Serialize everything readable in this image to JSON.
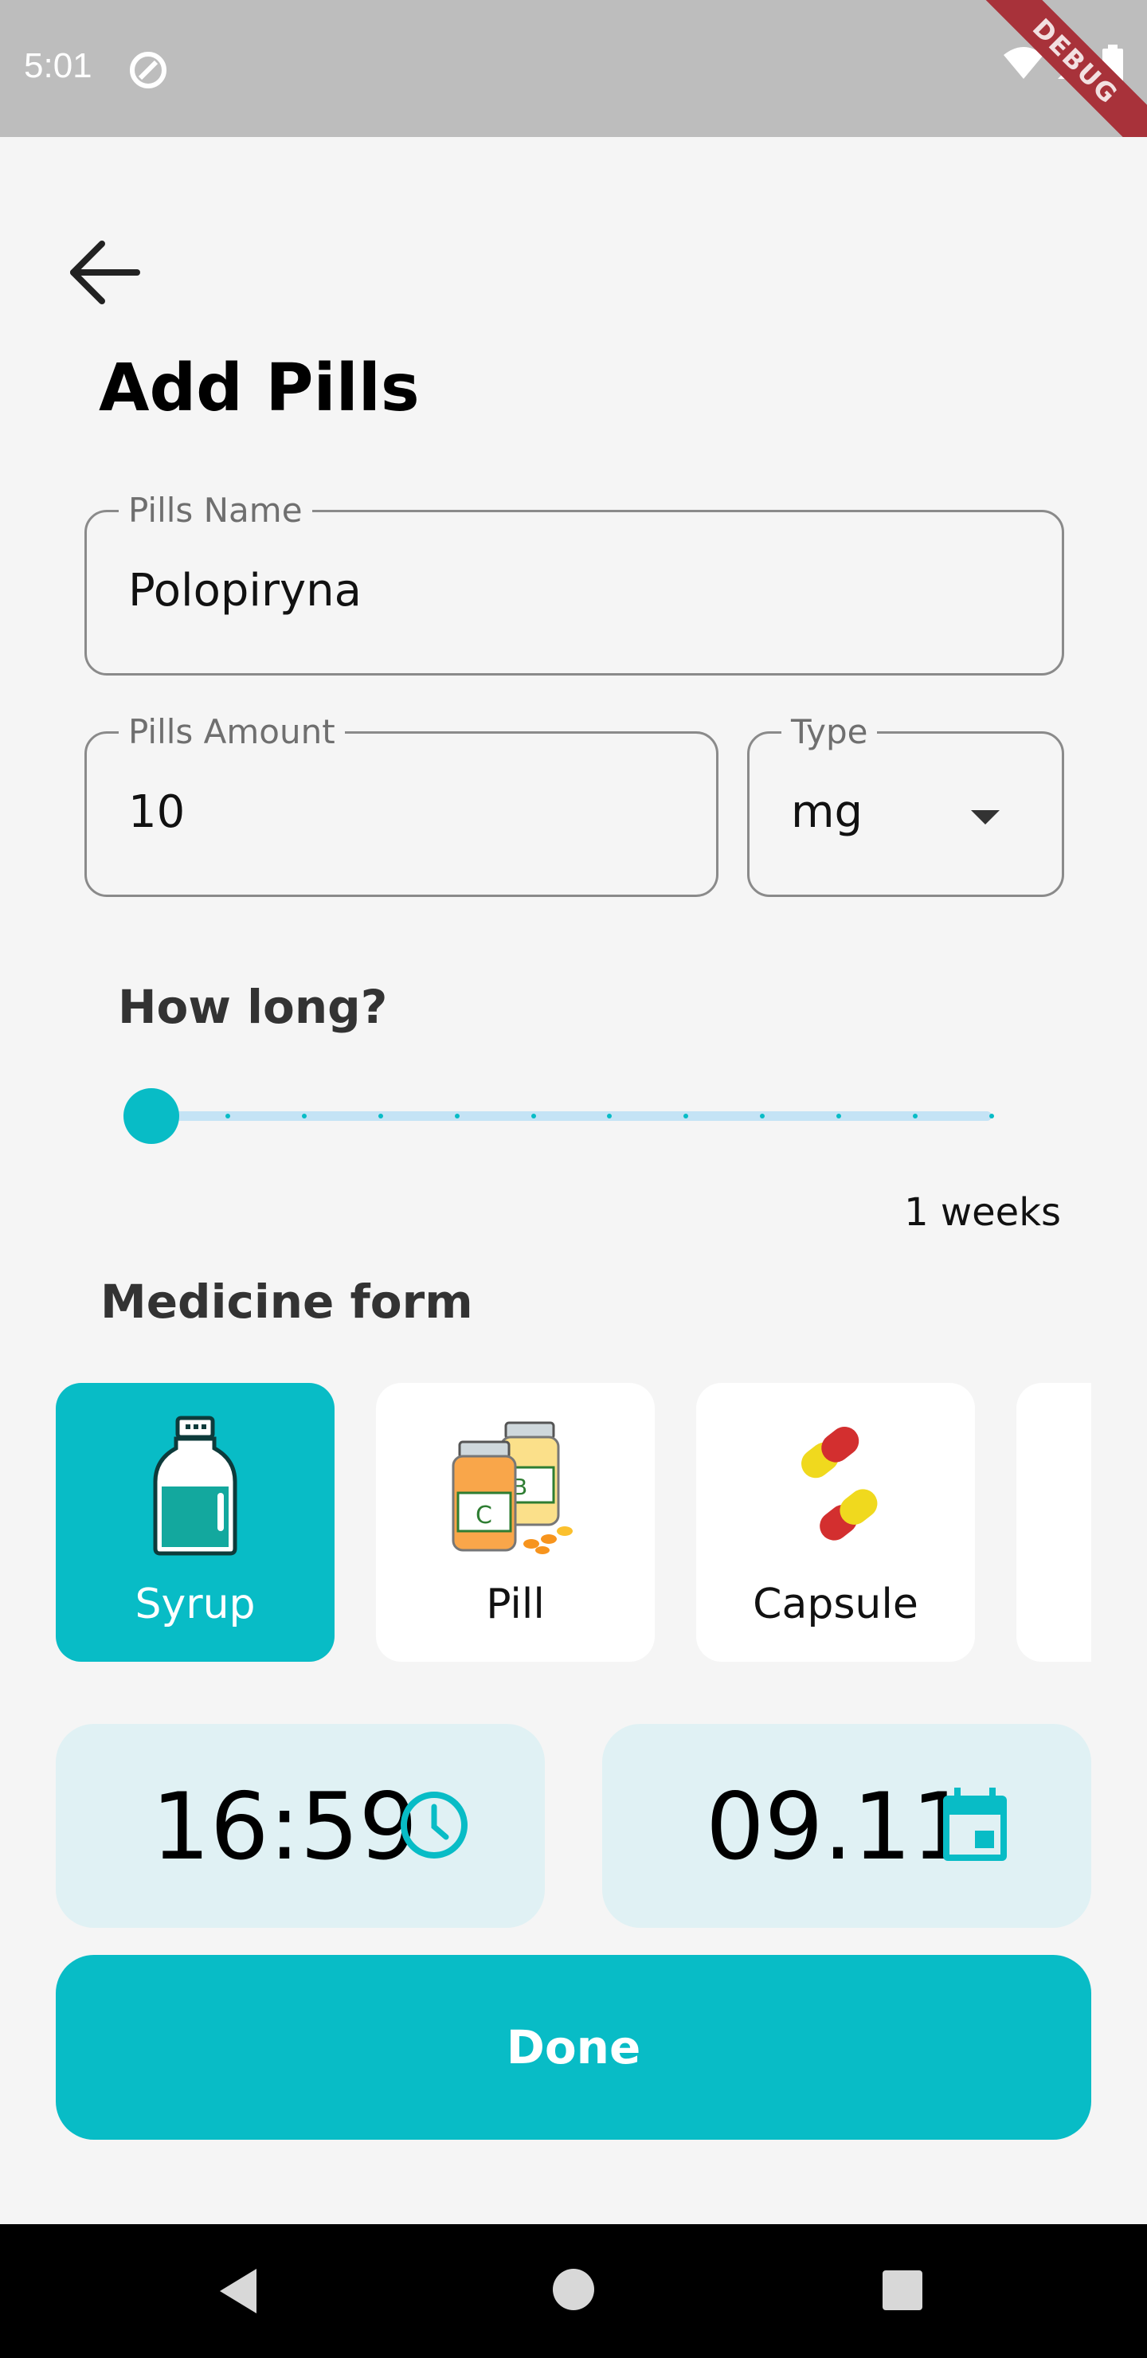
{
  "status_bar": {
    "time": "5:01",
    "debug_banner": "DEBUG",
    "icons": [
      "wifi-icon",
      "signal-icon",
      "battery-icon"
    ]
  },
  "page": {
    "title": "Add Pills"
  },
  "pills_name": {
    "label": "Pills Name",
    "value": "Polopiryna"
  },
  "pills_amount": {
    "label": "Pills Amount",
    "value": "10"
  },
  "type": {
    "label": "Type",
    "value": "mg"
  },
  "duration": {
    "heading": "How long?",
    "value_text": "1 weeks",
    "slider_level": 1,
    "slider_steps": 12
  },
  "medicine_form": {
    "heading": "Medicine form",
    "items": [
      {
        "label": "Syrup",
        "icon": "syrup-bottle-icon",
        "selected": true
      },
      {
        "label": "Pill",
        "icon": "vitamin-jars-icon",
        "selected": false
      },
      {
        "label": "Capsule",
        "icon": "capsule-icon",
        "selected": false
      },
      {
        "label": "",
        "icon": "more-form-icon",
        "selected": false
      }
    ]
  },
  "time_card": {
    "value": "16:59",
    "icon": "clock-icon"
  },
  "date_card": {
    "value": "09.11",
    "icon": "calendar-icon"
  },
  "done_button": {
    "label": "Done"
  },
  "colors": {
    "accent": "#08bcc6",
    "card_bg": "#e0f1f4",
    "background": "#f5f5f5"
  }
}
